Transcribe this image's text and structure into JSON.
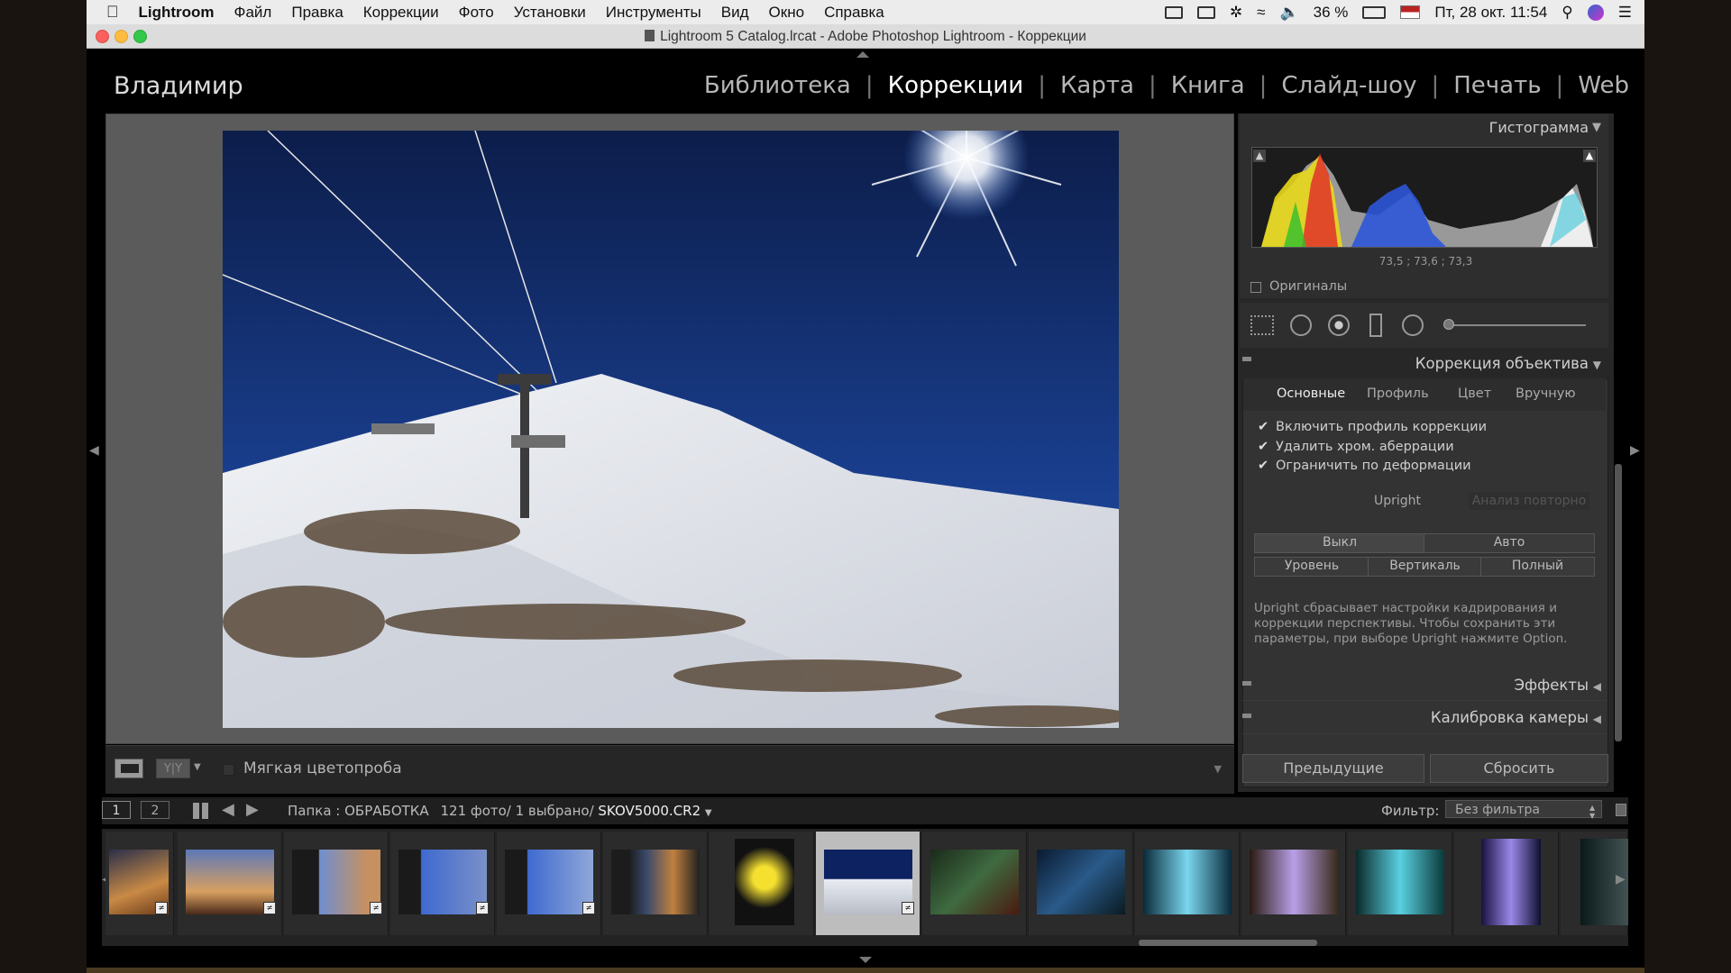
{
  "menubar": {
    "app": "Lightroom",
    "items": [
      "Файл",
      "Правка",
      "Коррекции",
      "Фото",
      "Установки",
      "Инструменты",
      "Вид",
      "Окно",
      "Справка"
    ],
    "battery": "36 %",
    "datetime": "Пт, 28 окт.  11:54"
  },
  "window": {
    "title": "Lightroom 5 Catalog.lrcat - Adobe Photoshop Lightroom - Коррекции"
  },
  "header": {
    "identity": "Владимир",
    "modules": [
      "Библиотека",
      "Коррекции",
      "Карта",
      "Книга",
      "Слайд-шоу",
      "Печать",
      "Web"
    ],
    "active_module": "Коррекции"
  },
  "toolbar": {
    "soft_proof_label": "Мягкая цветопроба"
  },
  "histogram": {
    "title": "Гистограмма",
    "readout": "73,5 ; 73,6 ; 73,3",
    "originals_label": "Оригиналы"
  },
  "lens_panel": {
    "title": "Коррекция объектива",
    "tabs": [
      "Основные",
      "Профиль",
      "Цвет",
      "Вручную"
    ],
    "active_tab": "Основные",
    "checkboxes": [
      "Включить профиль коррекции",
      "Удалить хром. аберрации",
      "Ограничить по деформации"
    ],
    "upright_label": "Upright",
    "reanalyze_label": "Анализ повторно",
    "upright_buttons_row1": [
      "Выкл",
      "Авто"
    ],
    "upright_buttons_row2": [
      "Уровень",
      "Вертикаль",
      "Полный"
    ],
    "info_text": "Upright сбрасывает настройки кадрирования и коррекции перспективы. Чтобы сохранить эти параметры, при выборе Upright нажмите Option."
  },
  "effects_panel": {
    "title": "Эффекты"
  },
  "calibration_panel": {
    "title": "Калибровка камеры"
  },
  "bottom_buttons": {
    "previous": "Предыдущие",
    "reset": "Сбросить"
  },
  "filmstrip": {
    "page1": "1",
    "page2": "2",
    "source": "Папка : ОБРАБОТКА",
    "count": "121 фото/ 1 выбрано/",
    "filename": "SKOV5000.CR2",
    "filter_label": "Фильтр:",
    "filter_value": "Без фильтра",
    "selected_index": 7
  },
  "colors": {
    "accent_active_module": "#ffffff",
    "panel_bg": "#272727",
    "loupe_bg": "#5b5b5b"
  }
}
